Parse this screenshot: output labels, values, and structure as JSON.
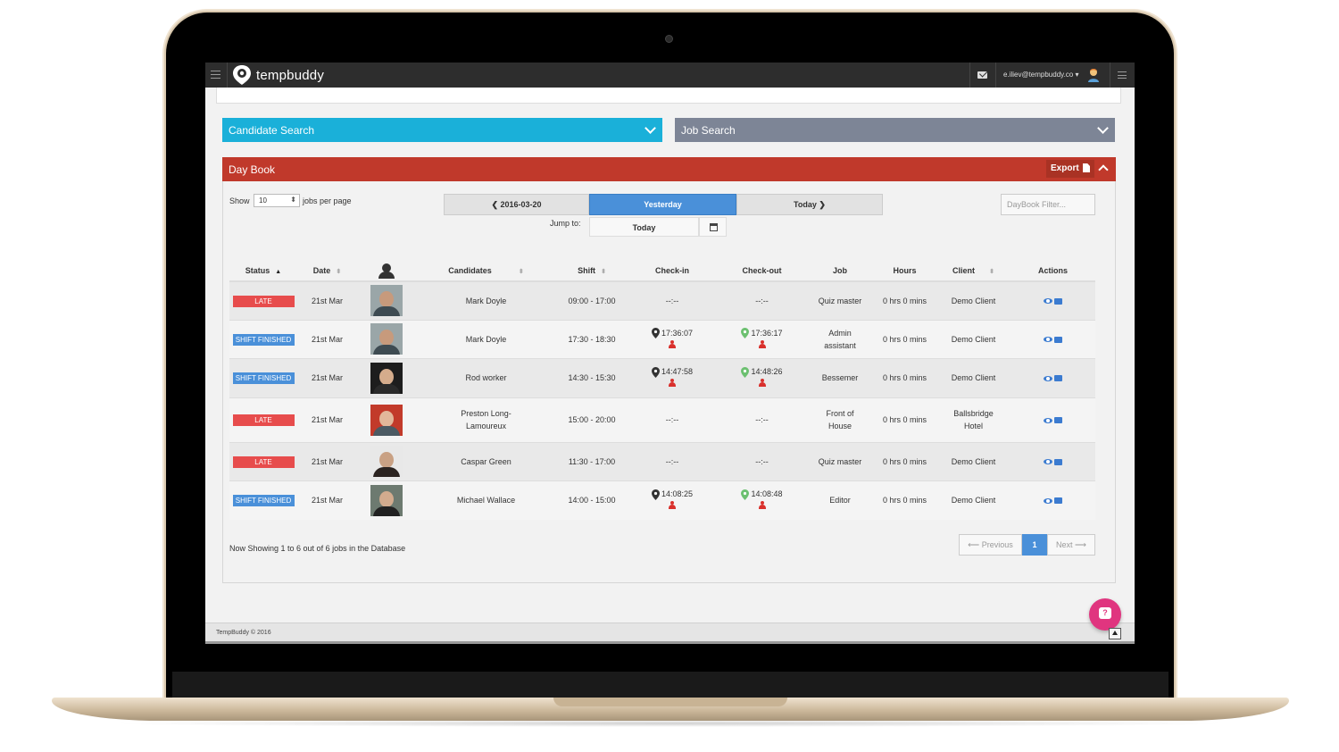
{
  "app": {
    "brand": "tempbuddy",
    "user_email": "e.iliev@tempbuddy.co",
    "colors": {
      "brand_dark": "#2d2d2d",
      "accent_blue": "#4a90d9",
      "candidate_cyan": "#1ab0d9",
      "daybook_red": "#c0392b",
      "late_red": "#e74c4c",
      "fab_pink": "#e0357f"
    }
  },
  "search": {
    "candidate_label": "Candidate Search",
    "job_label": "Job Search"
  },
  "daybook": {
    "title": "Day Book",
    "export_label": "Export",
    "show_label": "Show",
    "per_page_value": "10",
    "per_page_label": "jobs per page",
    "prev_day_label": "2016-03-20",
    "yesterday_label": "Yesterday",
    "today_label": "Today",
    "jump_label": "Jump to:",
    "jump_value": "Today",
    "filter_placeholder": "DayBook Filter...",
    "columns": [
      "Status",
      "Date",
      "",
      "Candidates",
      "Shift",
      "Check-in",
      "Check-out",
      "Job",
      "Hours",
      "Client",
      "Actions"
    ],
    "rows": [
      {
        "status": "LATE",
        "date": "21st Mar",
        "candidate": "Mark Doyle",
        "shift": "09:00 - 17:00",
        "checkin": "--:--",
        "checkout": "--:--",
        "job": "Quiz master",
        "hours": "0 hrs 0 mins",
        "client": "Demo Client"
      },
      {
        "status": "SHIFT FINISHED",
        "date": "21st Mar",
        "candidate": "Mark Doyle",
        "shift": "17:30 - 18:30",
        "checkin": "17:36:07",
        "checkout": "17:36:17",
        "job": "Admin assistant",
        "hours": "0 hrs 0 mins",
        "client": "Demo Client"
      },
      {
        "status": "SHIFT FINISHED",
        "date": "21st Mar",
        "candidate": "Rod worker",
        "shift": "14:30 - 15:30",
        "checkin": "14:47:58",
        "checkout": "14:48:26",
        "job": "Bessemer",
        "hours": "0 hrs 0 mins",
        "client": "Demo Client"
      },
      {
        "status": "LATE",
        "date": "21st Mar",
        "candidate": "Preston Long-Lamoureux",
        "shift": "15:00 - 20:00",
        "checkin": "--:--",
        "checkout": "--:--",
        "job": "Front of House",
        "hours": "0 hrs 0 mins",
        "client": "Ballsbridge Hotel"
      },
      {
        "status": "LATE",
        "date": "21st Mar",
        "candidate": "Caspar Green",
        "shift": "11:30 - 17:00",
        "checkin": "--:--",
        "checkout": "--:--",
        "job": "Quiz master",
        "hours": "0 hrs 0 mins",
        "client": "Demo Client"
      },
      {
        "status": "SHIFT FINISHED",
        "date": "21st Mar",
        "candidate": "Michael Wallace",
        "shift": "14:00 - 15:00",
        "checkin": "14:08:25",
        "checkout": "14:08:48",
        "job": "Editor",
        "hours": "0 hrs 0 mins",
        "client": "Demo Client"
      }
    ],
    "summary": "Now Showing 1 to 6 out of 6 jobs in the Database",
    "pager": {
      "prev": "Previous",
      "current": "1",
      "next": "Next"
    }
  },
  "footer": {
    "copyright": "TempBuddy © 2016"
  }
}
